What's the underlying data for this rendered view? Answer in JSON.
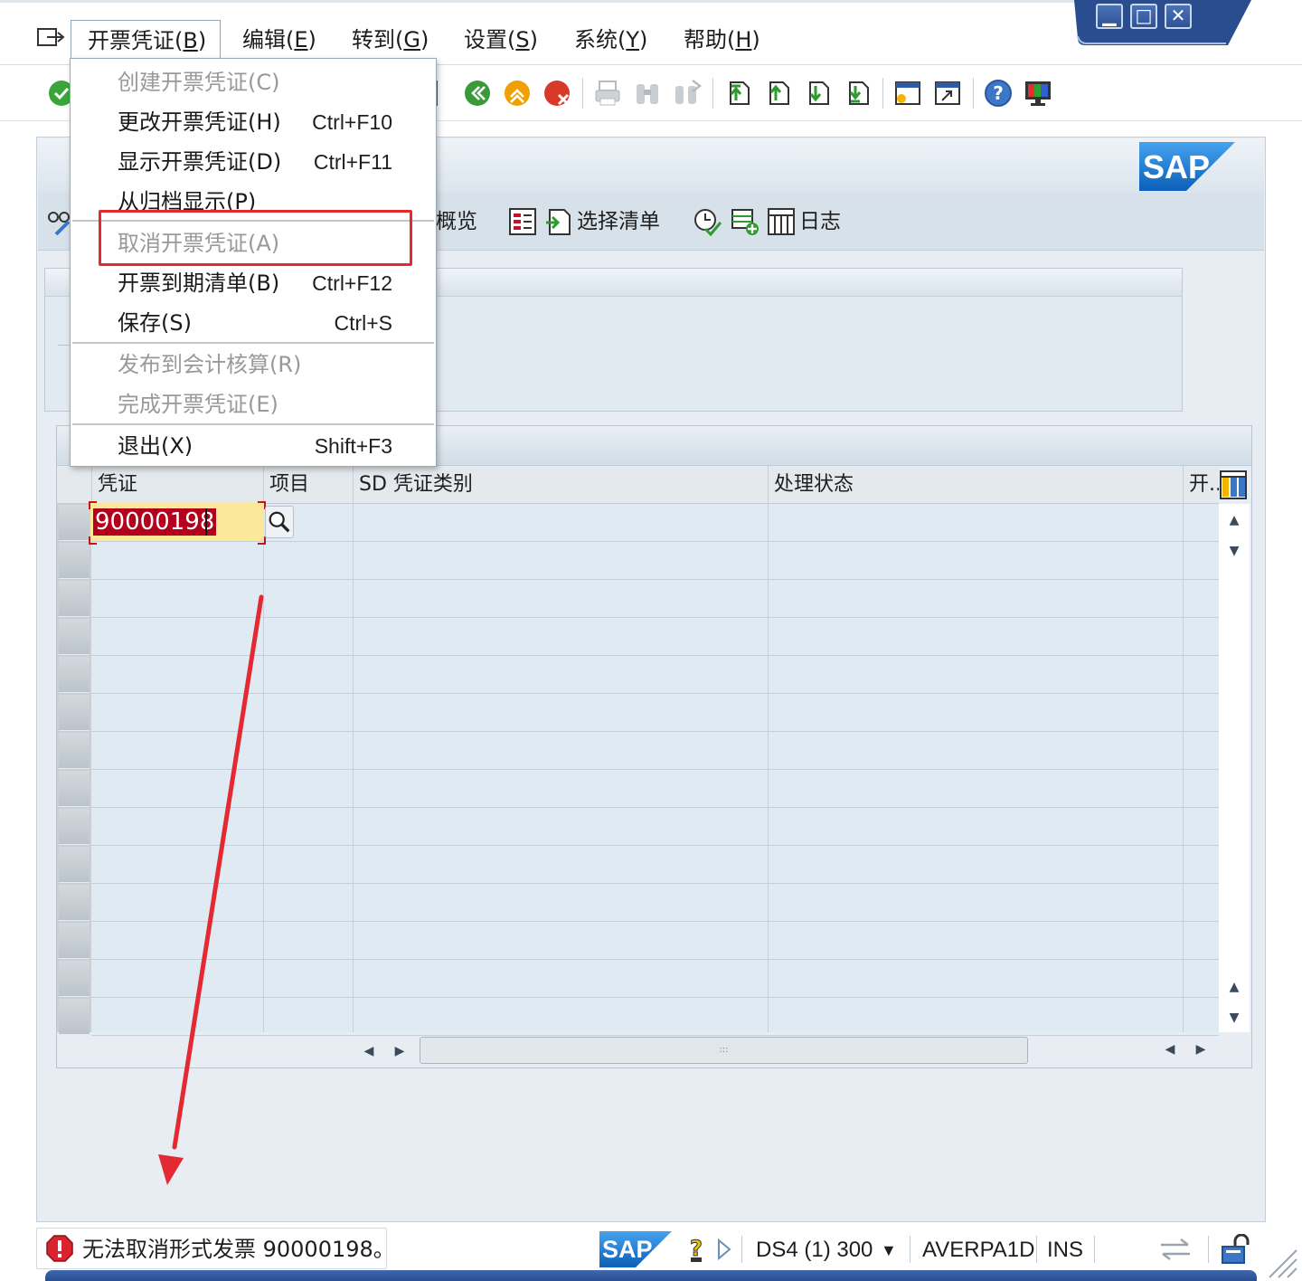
{
  "menubar": {
    "items": [
      {
        "label": "开票凭证(",
        "key": "B",
        "tail": ")"
      },
      {
        "label": "编辑(",
        "key": "E",
        "tail": ")"
      },
      {
        "label": "转到(",
        "key": "G",
        "tail": ")"
      },
      {
        "label": "设置(",
        "key": "S",
        "tail": ")"
      },
      {
        "label": "系统(",
        "key": "Y",
        "tail": ")"
      },
      {
        "label": "帮助(",
        "key": "H",
        "tail": ")"
      }
    ]
  },
  "window_controls": {
    "minimize": "▁",
    "maximize": "□",
    "close": "✕"
  },
  "dropdown": {
    "items": [
      {
        "label": "创建开票凭证(C)",
        "shortcut": "",
        "enabled": false
      },
      {
        "label": "更改开票凭证(H)",
        "shortcut": "Ctrl+F10",
        "enabled": true
      },
      {
        "label": "显示开票凭证(D)",
        "shortcut": "Ctrl+F11",
        "enabled": true
      },
      {
        "label": "从归档显示(P)",
        "shortcut": "",
        "enabled": true
      },
      {
        "label": "取消开票凭证(A)",
        "shortcut": "",
        "enabled": false
      },
      {
        "label": "开票到期清单(B)",
        "shortcut": "Ctrl+F12",
        "enabled": true
      },
      {
        "label": "保存(S)",
        "shortcut": "Ctrl+S",
        "enabled": true
      },
      {
        "label": "发布到会计核算(R)",
        "shortcut": "",
        "enabled": false
      },
      {
        "label": "完成开票凭证(E)",
        "shortcut": "",
        "enabled": false
      },
      {
        "label": "退出(X)",
        "shortcut": "Shift+F3",
        "enabled": true
      }
    ]
  },
  "apptoolbar": {
    "overview_label": "概览",
    "select_list_label": "选择清单",
    "log_label": "日志"
  },
  "logo_text": "SAP",
  "table": {
    "columns": [
      "凭证",
      "项目",
      "SD 凭证类别",
      "处理状态",
      "开.."
    ],
    "first_row_document": "90000198"
  },
  "statusbar": {
    "message": "无法取消形式发票 90000198。",
    "system": "DS4 (1) 300",
    "user": "AVERPA1D",
    "mode": "INS"
  },
  "colors": {
    "highlight": "#e32a32",
    "error_icon": "#d9232e",
    "sap_blue": "#1e74c6",
    "grid_background": "#dfeaf3"
  }
}
